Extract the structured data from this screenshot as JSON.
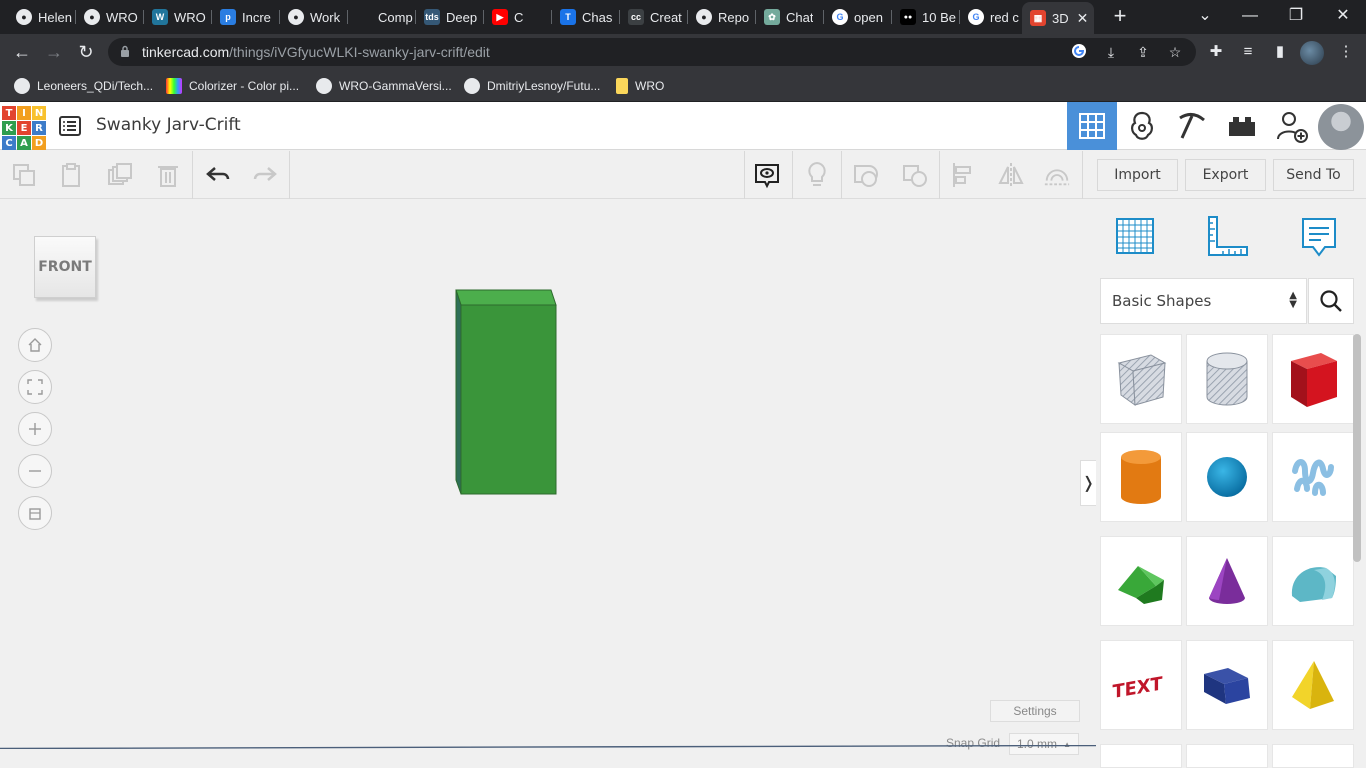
{
  "browser": {
    "tabs": [
      {
        "label": "Helen",
        "icon": "github-icon"
      },
      {
        "label": "WRO",
        "icon": "github-icon"
      },
      {
        "label": "WRO",
        "icon": "wordpress-icon"
      },
      {
        "label": "Incre",
        "icon": "pi-icon"
      },
      {
        "label": "Work",
        "icon": "github-icon"
      },
      {
        "label": "Comp",
        "icon": "blank-icon"
      },
      {
        "label": "Deep",
        "icon": "tds-icon"
      },
      {
        "label": "C",
        "icon": "youtube-icon"
      },
      {
        "label": "Chas",
        "icon": "t-icon"
      },
      {
        "label": "Creat",
        "icon": "cc-icon"
      },
      {
        "label": "Repo",
        "icon": "github-icon"
      },
      {
        "label": "Chat",
        "icon": "chatgpt-icon"
      },
      {
        "label": "open",
        "icon": "google-icon"
      },
      {
        "label": "10 Be",
        "icon": "medium-icon"
      },
      {
        "label": "red c",
        "icon": "google-icon"
      },
      {
        "label": "3D",
        "icon": "tinkercad-icon"
      }
    ],
    "url_host": "tinkercad.com",
    "url_path": "/things/iVGfyucWLKI-swanky-jarv-crift/edit",
    "bookmarks": [
      "Leoneers_QDi/Tech...",
      "Colorizer - Color pi...",
      "WRO-GammaVersi...",
      "DmitriyLesnoy/Futu...",
      "WRO"
    ]
  },
  "app": {
    "logo_letters": [
      "T",
      "I",
      "N",
      "K",
      "E",
      "R",
      "C",
      "A",
      "D"
    ],
    "logo_colors": [
      "#e2442f",
      "#f29f1f",
      "#f8c12d",
      "#2f9e4f",
      "#e2442f",
      "#3d7cc9",
      "#3d7cc9",
      "#2f9e4f",
      "#f29f1f"
    ],
    "design_title": "Swanky Jarv-Crift",
    "accent_color": "#4a90d9"
  },
  "toolbar": {
    "import_label": "Import",
    "export_label": "Export",
    "send_to_label": "Send To"
  },
  "workplane": {
    "viewcube_label": "FRONT",
    "settings_label": "Settings",
    "snap_grid_label": "Snap Grid",
    "snap_grid_value": "1.0 mm",
    "object_color": "#3a953a"
  },
  "panel": {
    "category": "Basic Shapes",
    "shapes": [
      "box-hole",
      "cylinder-hole",
      "box",
      "cylinder",
      "sphere",
      "scribble",
      "roof",
      "cone",
      "round-roof",
      "text",
      "prism",
      "pyramid"
    ]
  }
}
